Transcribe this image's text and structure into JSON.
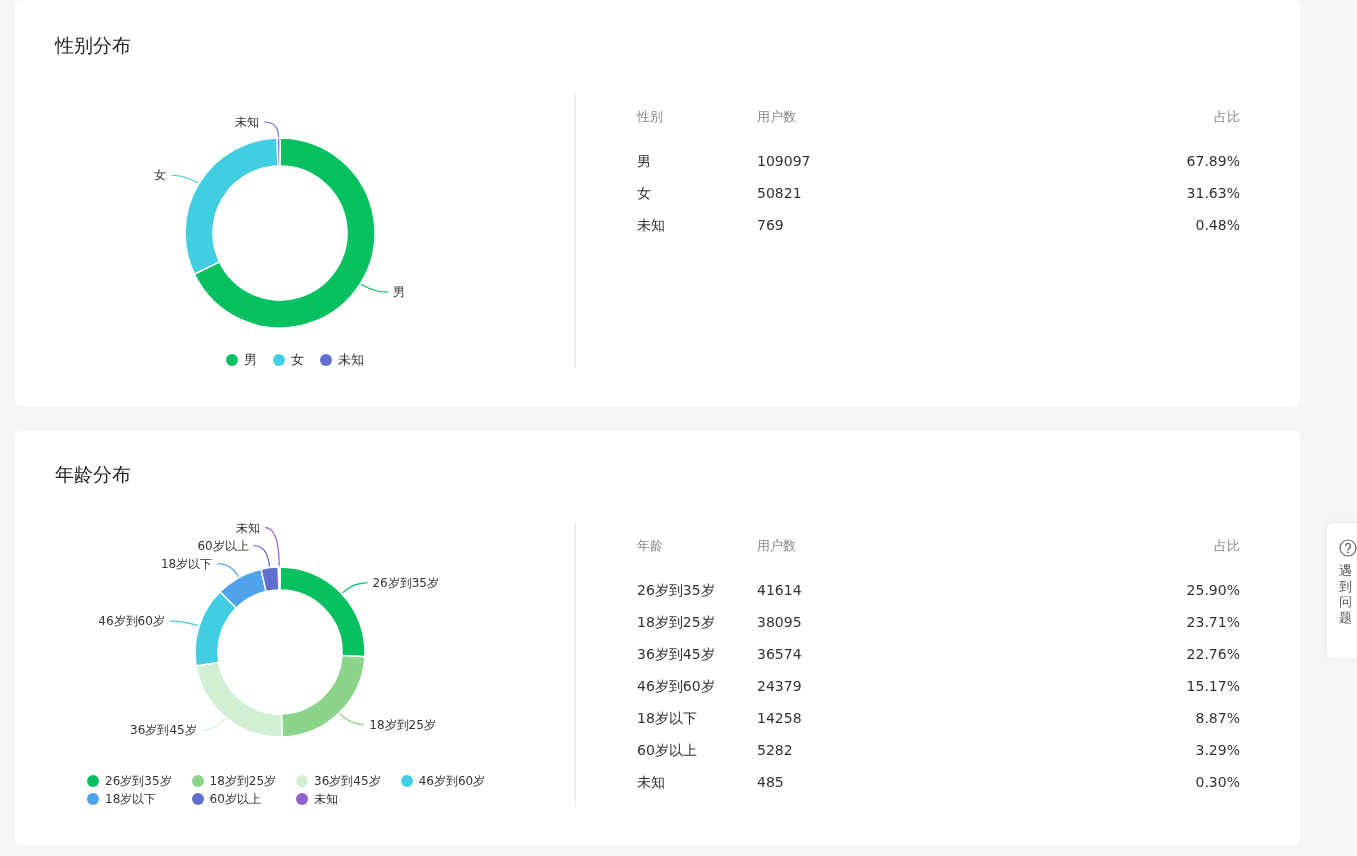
{
  "cards": [
    {
      "title": "性别分布",
      "chart": {
        "slice_labels": [
          "男",
          "女",
          "未知"
        ],
        "legend": [
          {
            "label": "男",
            "color": "#07c160"
          },
          {
            "label": "女",
            "color": "#41cde2"
          },
          {
            "label": "未知",
            "color": "#5f6fce"
          }
        ]
      },
      "table": {
        "columns": [
          "性别",
          "用户数",
          "占比"
        ],
        "rows": [
          [
            "男",
            "109097",
            "67.89%"
          ],
          [
            "女",
            "50821",
            "31.63%"
          ],
          [
            "未知",
            "769",
            "0.48%"
          ]
        ]
      }
    },
    {
      "title": "年龄分布",
      "chart": {
        "slice_labels": [
          "26岁到35岁",
          "18岁到25岁",
          "36岁到45岁",
          "46岁到60岁",
          "18岁以下",
          "60岁以上",
          "未知"
        ],
        "legend": [
          {
            "label": "26岁到35岁",
            "color": "#07c160"
          },
          {
            "label": "18岁到25岁",
            "color": "#8dd48b"
          },
          {
            "label": "36岁到45岁",
            "color": "#d1efd3"
          },
          {
            "label": "46岁到60岁",
            "color": "#41cde2"
          },
          {
            "label": "18岁以下",
            "color": "#4fa3ea"
          },
          {
            "label": "60岁以上",
            "color": "#5f6fce"
          },
          {
            "label": "未知",
            "color": "#8f5fce"
          }
        ]
      },
      "table": {
        "columns": [
          "年龄",
          "用户数",
          "占比"
        ],
        "rows": [
          [
            "26岁到35岁",
            "41614",
            "25.90%"
          ],
          [
            "18岁到25岁",
            "38095",
            "23.71%"
          ],
          [
            "36岁到45岁",
            "36574",
            "22.76%"
          ],
          [
            "46岁到60岁",
            "24379",
            "15.17%"
          ],
          [
            "18岁以下",
            "14258",
            "8.87%"
          ],
          [
            "60岁以上",
            "5282",
            "3.29%"
          ],
          [
            "未知",
            "485",
            "0.30%"
          ]
        ]
      }
    }
  ],
  "help": {
    "label": "遇到问题"
  }
}
